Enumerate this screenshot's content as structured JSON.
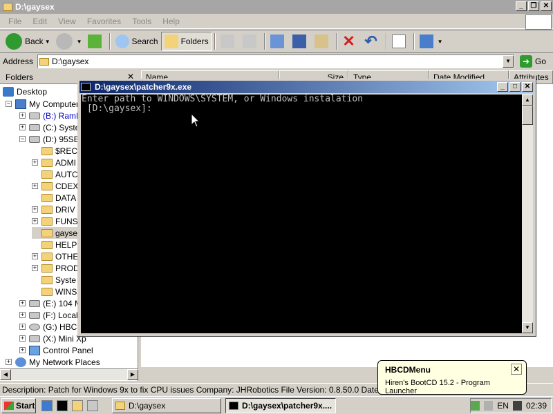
{
  "explorer": {
    "title": "D:\\gaysex",
    "menu": [
      "File",
      "Edit",
      "View",
      "Favorites",
      "Tools",
      "Help"
    ],
    "toolbar": {
      "back_label": "Back",
      "search_label": "Search",
      "folders_label": "Folders"
    },
    "address": {
      "label": "Address",
      "value": "D:\\gaysex",
      "go_label": "Go"
    },
    "folders_panel_title": "Folders",
    "tree": [
      {
        "label": "Desktop",
        "icon": "desktop-icon"
      },
      {
        "label": "My Computer",
        "icon": "computer-icon"
      },
      {
        "label": "(B:) RamD",
        "icon": "drive-icon"
      },
      {
        "label": "(C:) Syste",
        "icon": "drive-icon"
      },
      {
        "label": "(D:) 95SE",
        "icon": "drive-icon"
      },
      {
        "label": "$REC",
        "icon": "folder-icon"
      },
      {
        "label": "ADMI",
        "icon": "folder-icon"
      },
      {
        "label": "AUTC",
        "icon": "folder-icon"
      },
      {
        "label": "CDEX",
        "icon": "folder-icon"
      },
      {
        "label": "DATA",
        "icon": "folder-icon"
      },
      {
        "label": "DRIV",
        "icon": "folder-icon"
      },
      {
        "label": "FUNS",
        "icon": "folder-icon"
      },
      {
        "label": "gayse",
        "icon": "folder-open-icon"
      },
      {
        "label": "HELP",
        "icon": "folder-icon"
      },
      {
        "label": "OTHE",
        "icon": "folder-icon"
      },
      {
        "label": "PROD",
        "icon": "folder-icon"
      },
      {
        "label": "Syste",
        "icon": "folder-icon"
      },
      {
        "label": "WINS",
        "icon": "folder-icon"
      },
      {
        "label": "(E:) 104 M",
        "icon": "drive-icon"
      },
      {
        "label": "(F:) Local",
        "icon": "drive-icon"
      },
      {
        "label": "(G:) HBCD",
        "icon": "cd-drive-icon"
      },
      {
        "label": "(X:) Mini Xp",
        "icon": "drive-icon"
      },
      {
        "label": "Control Panel",
        "icon": "control-panel-icon"
      },
      {
        "label": "My Network Places",
        "icon": "network-icon"
      }
    ],
    "columns": [
      "Name",
      "Size",
      "Type",
      "Date Modified",
      "Attributes"
    ],
    "status_text": "Description: Patch for Windows 9x to fix CPU issues Company: JHRobotics File Version: 0.8.50.0 Date Created: 202"
  },
  "console": {
    "title": "D:\\gaysex\\patcher9x.exe",
    "line1": "Enter path to WINDOWS\\SYSTEM, or Windows instalation",
    "line2": " [D:\\gaysex]:"
  },
  "balloon": {
    "title": "HBCDMenu",
    "text": "Hiren's BootCD 15.2 - Program Launcher"
  },
  "taskbar": {
    "start_label": "Start",
    "tasks": [
      "D:\\gaysex",
      "D:\\gaysex\\patcher9x...."
    ],
    "language": "EN",
    "clock": "02:39"
  },
  "colors": {
    "title_active": "#0a246a",
    "title_inactive": "#a6a6a6",
    "face": "#d4d0c8",
    "console_bg": "#000000",
    "console_fg": "#c0c0c0",
    "balloon_bg": "#ffffe1"
  }
}
